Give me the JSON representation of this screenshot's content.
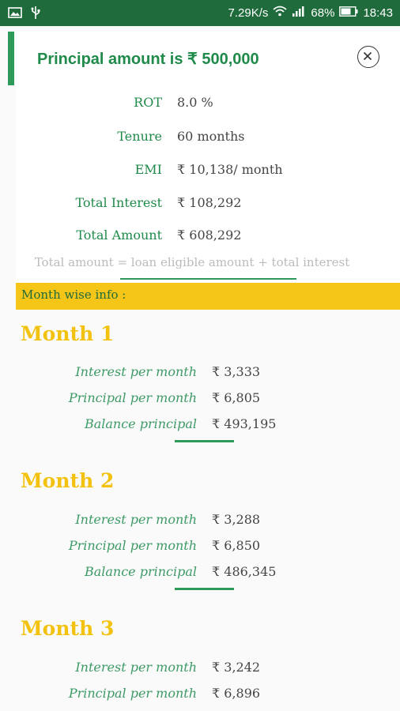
{
  "status_bar": {
    "network_speed": "7.29K/s",
    "battery": "68%",
    "time": "18:43",
    "icons": [
      "gallery-icon",
      "usb-icon",
      "wifi-icon",
      "signal-icon",
      "battery-icon"
    ]
  },
  "dialog": {
    "title": "Principal amount is ₹ 500,000",
    "close_icon": "close-icon"
  },
  "summary": {
    "rows": [
      {
        "label": "ROT",
        "value": "8.0 %"
      },
      {
        "label": "Tenure",
        "value": "60 months"
      },
      {
        "label": "EMI",
        "value": "₹ 10,138/ month"
      },
      {
        "label": "Total Interest",
        "value": "₹ 108,292"
      },
      {
        "label": "Total Amount",
        "value": "₹ 608,292"
      }
    ],
    "formula": "Total amount = loan eligible amount + total interest"
  },
  "month_wise": {
    "header": "Month wise info :",
    "months": [
      {
        "title": "Month 1",
        "rows": [
          {
            "label": "Interest per month",
            "value": "₹ 3,333"
          },
          {
            "label": "Principal per month",
            "value": "₹ 6,805"
          },
          {
            "label": "Balance principal",
            "value": "₹ 493,195"
          }
        ]
      },
      {
        "title": "Month 2",
        "rows": [
          {
            "label": "Interest per month",
            "value": "₹ 3,288"
          },
          {
            "label": "Principal per month",
            "value": "₹ 6,850"
          },
          {
            "label": "Balance principal",
            "value": "₹ 486,345"
          }
        ]
      },
      {
        "title": "Month 3",
        "rows": [
          {
            "label": "Interest per month",
            "value": "₹ 3,242"
          },
          {
            "label": "Principal per month",
            "value": "₹ 6,896"
          }
        ]
      }
    ]
  },
  "colors": {
    "status_bar": "#1f6b3c",
    "accent_green": "#2e9a5a",
    "title_green": "#1f8a4a",
    "banner_yellow": "#f5c518",
    "month_yellow": "#f2c20e"
  }
}
